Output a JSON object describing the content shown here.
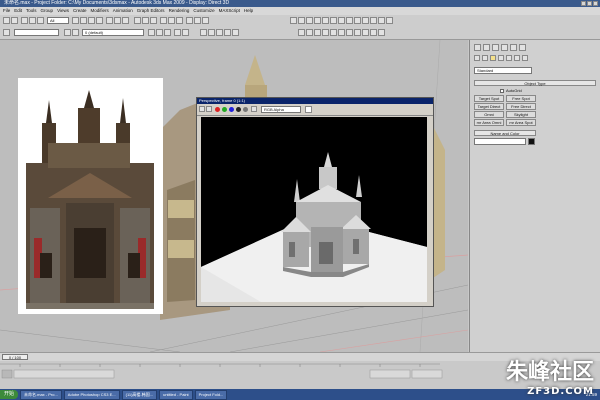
{
  "window": {
    "title": "未命名.max - Project Folder: C:\\My Documents\\3dsmax - Autodesk 3ds Max 2009 - Display: Direct 3D"
  },
  "menu": [
    "File",
    "Edit",
    "Tools",
    "Group",
    "Views",
    "Create",
    "Modifiers",
    "Animation",
    "Graph Editors",
    "Rendering",
    "Customize",
    "MAXScript",
    "Help"
  ],
  "toolbar": {
    "selection_filter": "All",
    "layer_dropdown": "0 (default)"
  },
  "render_window": {
    "title": "Perspective, frame 0 (1:1)",
    "channel": "RGB Alpha"
  },
  "command_panel": {
    "standard_dropdown": "Standard",
    "object_type_label": "Object Type",
    "autogrid_label": "AutoGrid",
    "buttons": [
      [
        "Target Spot",
        "Free Spot"
      ],
      [
        "Target Direct",
        "Free Direct"
      ],
      [
        "Omni",
        "Skylight"
      ],
      [
        "mr Area Omni",
        "mr Area Spot"
      ]
    ],
    "name_color_label": "Name and Color"
  },
  "timeline": {
    "frame_label": "0 / 100"
  },
  "taskbar": {
    "start": "开始",
    "items": [
      "",
      "未命名.max - Pro...",
      "Adobe Photoshop CS3 E...",
      "(11)高楼-韩国...",
      "untitled - Paint",
      "Project Fold..."
    ],
    "clock": "21:59"
  },
  "watermark": {
    "cn": "朱峰社区",
    "en": "ZF3D.COM"
  },
  "colors": {
    "accent": "#0a246a",
    "viewport_bg": "#bdbdbd",
    "taskbar": "#2d4f8a"
  }
}
